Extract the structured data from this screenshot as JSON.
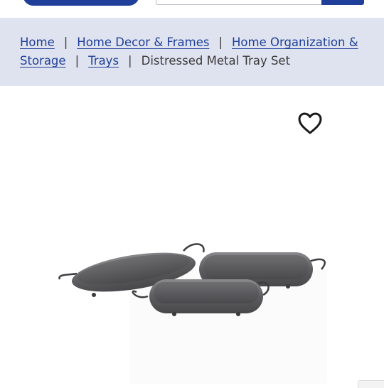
{
  "breadcrumb": {
    "items": [
      {
        "label": "Home"
      },
      {
        "label": "Home Decor & Frames"
      },
      {
        "label": "Home Organization & Storage"
      },
      {
        "label": "Trays"
      }
    ],
    "current": "Distressed Metal Tray Set",
    "separator": "|"
  },
  "product": {
    "wishlist_icon": "heart-outline-icon",
    "image_alt": "Distressed Metal Tray Set"
  },
  "colors": {
    "brand_blue": "#1f3f9a",
    "breadcrumb_bg": "#dfe3ef",
    "text": "#3a3a3a"
  }
}
